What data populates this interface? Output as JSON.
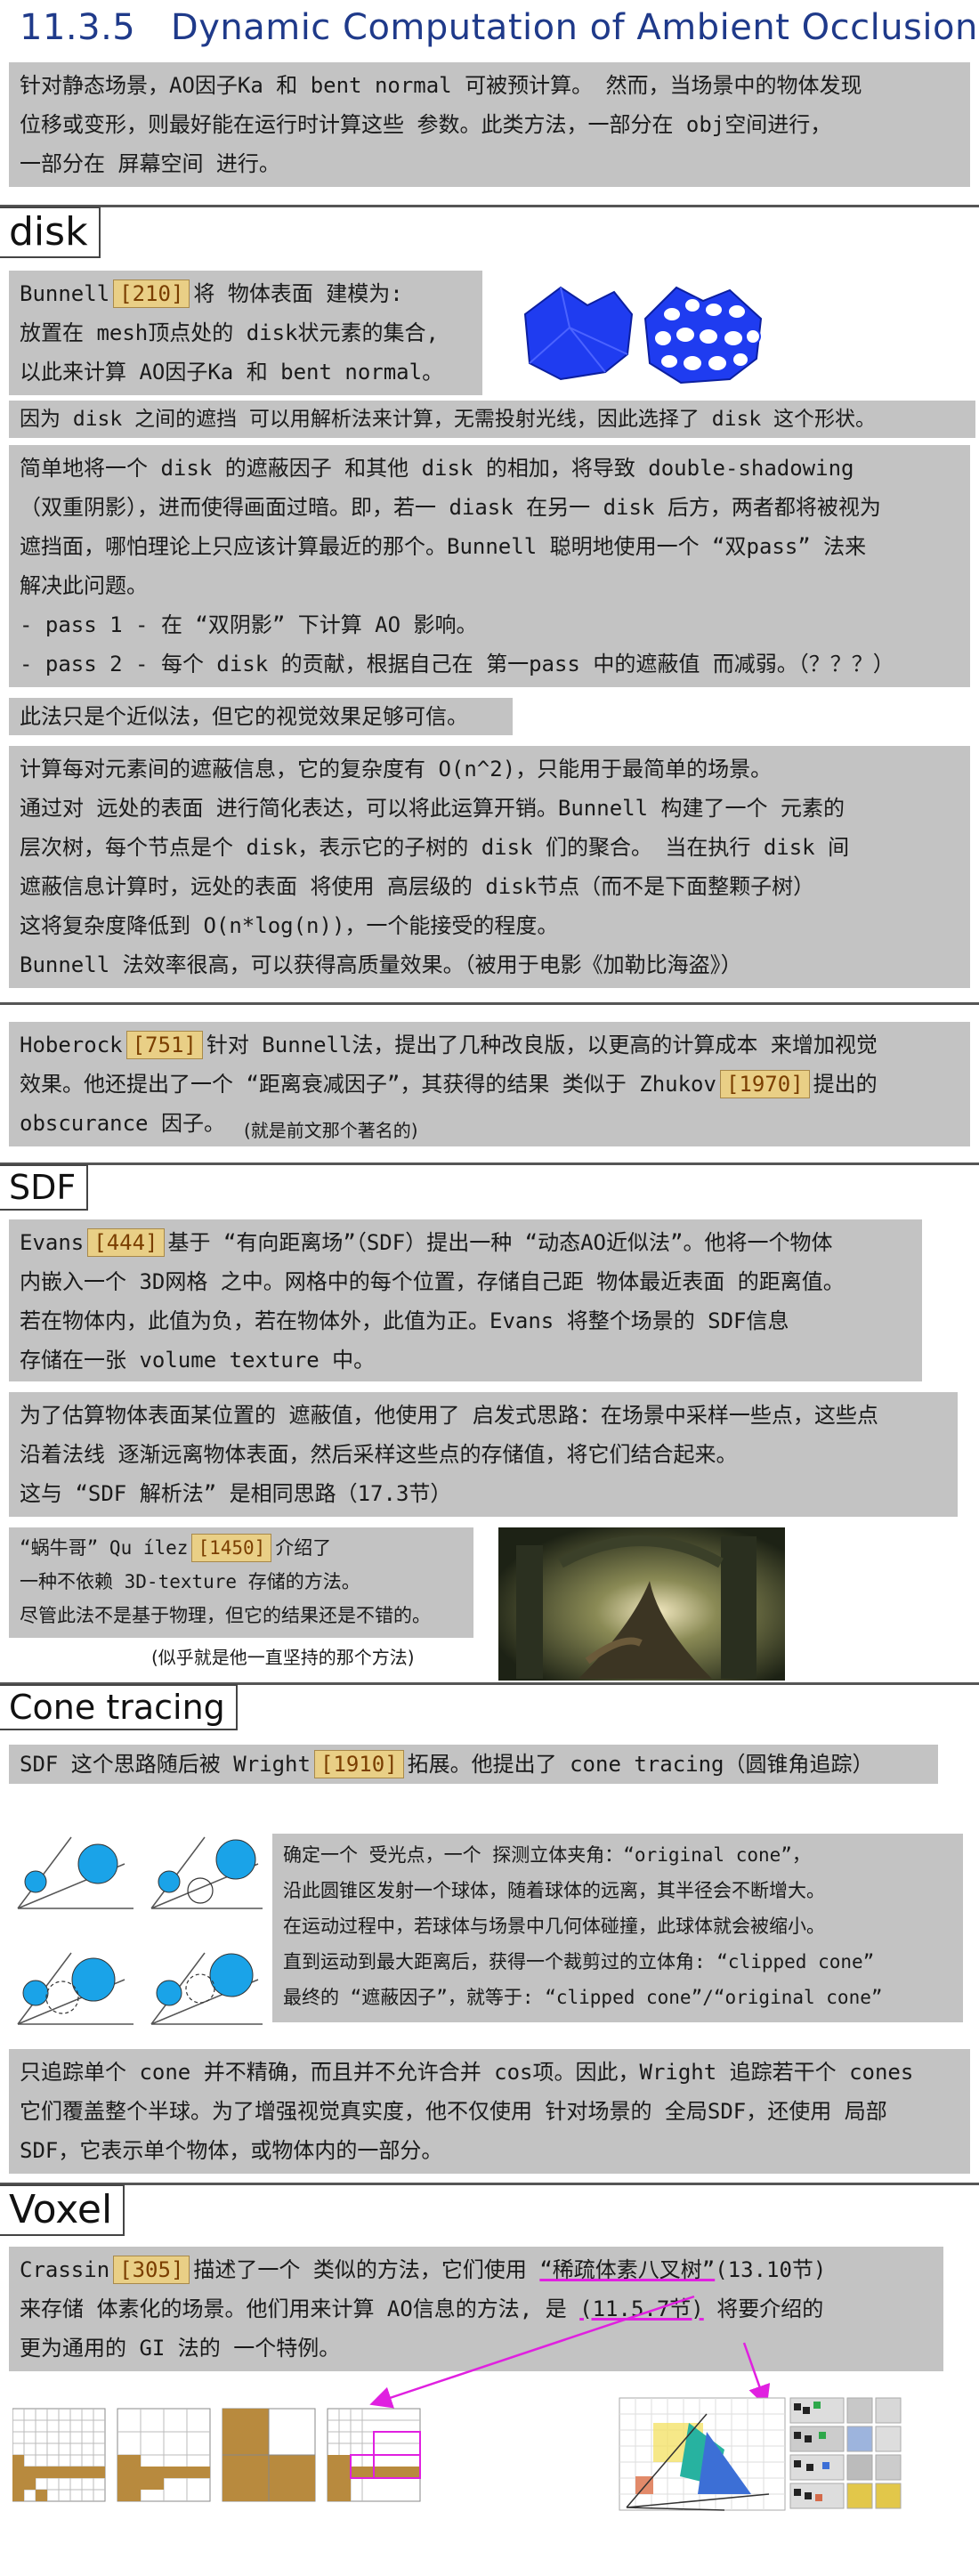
{
  "title": {
    "number": "11.3.5",
    "text": "Dynamic Computation of Ambient Occlusion"
  },
  "intro": [
    "针对静态场景，AO因子Ka 和 bent normal 可被预计算。 然而，当场景中的物体发现",
    "位移或变形，则最好能在运行时计算这些 参数。此类方法，一部分在 obj空间进行，",
    "一部分在 屏幕空间 进行。"
  ],
  "disk": {
    "heading": "disk",
    "p1": {
      "l1a": "Bunnell",
      "cite": "[210]",
      "l1b": "将 物体表面 建模为:",
      "l2": "放置在 mesh顶点处的 disk状元素的集合,",
      "l3": "以此来计算 AO因子Ka 和 bent normal。"
    },
    "p2": "因为 disk 之间的遮挡 可以用解析法来计算，无需投射光线，因此选择了 disk 这个形状。",
    "p3": [
      "简单地将一个 disk 的遮蔽因子 和其他 disk 的相加，将导致 double-shadowing",
      "（双重阴影），进而使得画面过暗。即，若一 diask 在另一 disk 后方，两者都将被视为",
      "遮挡面，哪怕理论上只应该计算最近的那个。Bunnell 聪明地使用一个 “双pass” 法来",
      "解决此问题。",
      "- pass 1 - 在 “双阴影” 下计算 AO 影响。",
      "- pass 2 - 每个 disk 的贡献，根据自己在 第一pass 中的遮蔽值 而减弱。（？？？）"
    ],
    "p4": "此法只是个近似法，但它的视觉效果足够可信。",
    "p5": [
      "计算每对元素间的遮蔽信息，它的复杂度有 O(n^2)，只能用于最简单的场景。",
      "通过对 远处的表面 进行简化表达，可以将此运算开销。Bunnell 构建了一个 元素的",
      "层次树，每个节点是个 disk，表示它的子树的 disk 们的聚合。 当在执行 disk 间",
      "遮蔽信息计算时，远处的表面 将使用 高层级的 disk节点（而不是下面整颗子树）",
      "这将复杂度降低到 O(n*log(n))，一个能接受的程度。",
      "Bunnell 法效率很高，可以获得高质量效果。（被用于电影《加勒比海盗》）"
    ],
    "p6": {
      "l1a": "Hoberock",
      "cite1": "[751]",
      "l1b": "针对 Bunnell法，提出了几种改良版，以更高的计算成本 来增加视觉",
      "l2a": "效果。他还提出了一个 “距离衰减因子”，其获得的结果 类似于 Zhukov",
      "cite2": "[1970]",
      "l2b": "提出的",
      "l3": "obscurance 因子。",
      "note": "(就是前文那个著名的)"
    }
  },
  "sdf": {
    "heading": "SDF",
    "p1": {
      "l1a": "Evans",
      "cite": "[444]",
      "l1b": "基于 “有向距离场”（SDF）提出一种 “动态AO近似法”。他将一个物体",
      "l2": "内嵌入一个 3D网格 之中。网格中的每个位置，存储自己距 物体最近表面 的距离值。",
      "l3": "若在物体内，此值为负，若在物体外，此值为正。Evans 将整个场景的 SDF信息",
      "l4": "存储在一张 volume texture 中。"
    },
    "p2": [
      "为了估算物体表面某位置的 遮蔽值，他使用了 启发式思路：在场景中采样一些点，这些点",
      "沿着法线 逐渐远离物体表面，然后采样这些点的存储值，将它们结合起来。",
      "这与 “SDF 解析法” 是相同思路（17.3节）"
    ],
    "p3": {
      "l1a": "“蜗牛哥” Qu ílez",
      "cite": "[1450]",
      "l1b": "介绍了",
      "l2": "一种不依赖 3D-texture 存储的方法。",
      "l3": "尽管此法不是基于物理，但它的结果还是不错的。",
      "note": "(似乎就是他一直坚持的那个方法)"
    }
  },
  "cone": {
    "heading": "Cone tracing",
    "p1": {
      "a": "SDF 这个思路随后被 Wright",
      "cite": "[1910]",
      "b": "拓展。他提出了 cone tracing（圆锥角追踪）"
    },
    "p2": [
      "确定一个 受光点，一个 探测立体夹角：“original cone”，",
      "沿此圆锥区发射一个球体，随着球体的远离，其半径会不断增大。",
      "在运动过程中，若球体与场景中几何体碰撞，此球体就会被缩小。",
      "直到运动到最大距离后，获得一个裁剪过的立体角: “clipped cone”",
      "最终的 “遮蔽因子”，就等于: “clipped cone”/“original cone”"
    ],
    "p3": [
      "只追踪单个 cone 并不精确，而且并不允许合并 cos项。因此，Wright 追踪若干个 cones",
      "它们覆盖整个半球。为了增强视觉真实度，他不仅使用 针对场景的 全局SDF，还使用 局部",
      "SDF，它表示单个物体，或物体内的一部分。"
    ]
  },
  "voxel": {
    "heading": "Voxel",
    "p1": {
      "l1a": "Crassin",
      "cite": "[305]",
      "l1b": "描述了一个 类似的方法，它们使用",
      "l1c": "“稀疏体素八叉树”",
      "l1d": "(13.10节)",
      "l2a": "来存储 体素化的场景。他们用来计算 AO信息的方法, 是",
      "l2b": "(11.5.7节)",
      "l2c": "将要介绍的",
      "l3": "更为通用的 GI 法的 一个特例。"
    }
  },
  "colors": {
    "box": "#c3c3c3",
    "cite_bg": "#e9cf86",
    "title": "#1f3a8a",
    "arrow": "#e020e0",
    "sphere": "#1aa3e8",
    "disk_blue": "#1f3cf0",
    "voxel_brown": "#b88a3e"
  }
}
